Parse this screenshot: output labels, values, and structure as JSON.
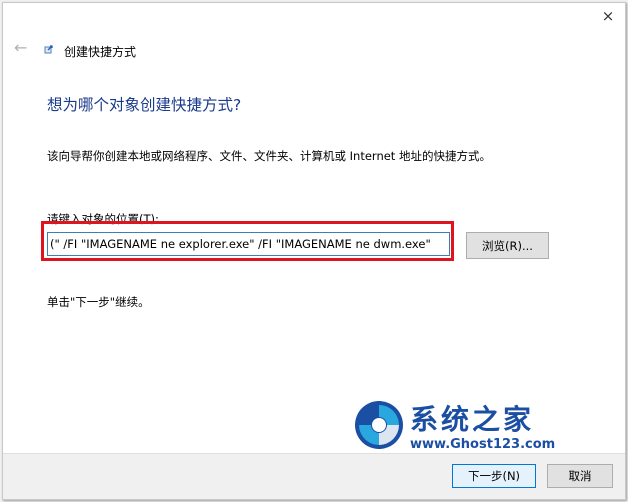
{
  "window": {
    "title": "创建快捷方式",
    "close_glyph": "×",
    "back_glyph": "←"
  },
  "content": {
    "heading": "想为哪个对象创建快捷方式?",
    "description": "该向导帮你创建本地或网络程序、文件、文件夹、计算机或 Internet 地址的快捷方式。",
    "location_label": "请键入对象的位置(T):",
    "location_value": "(\" /FI \"IMAGENAME ne explorer.exe\" /FI \"IMAGENAME ne dwm.exe\"",
    "browse_label": "浏览(R)...",
    "instruction": "单击\"下一步\"继续。"
  },
  "footer": {
    "next_label": "下一步(N)",
    "cancel_label": "取消"
  },
  "watermark": {
    "name": "系统之家",
    "url": "www.Ghost123.com"
  },
  "colors": {
    "heading": "#1a3a8c",
    "highlight": "#e0141e",
    "accent": "#0078d7"
  }
}
